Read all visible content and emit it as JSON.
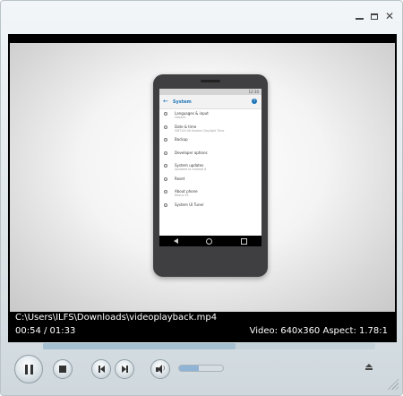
{
  "window": {
    "minimize_icon": "minimize-icon",
    "maximize_icon": "maximize-icon",
    "close_icon": "close-icon",
    "close_glyph": "✕"
  },
  "video": {
    "phone_screen": {
      "status_time": "12:30",
      "title": "System",
      "items": [
        {
          "title": "Languages & input",
          "subtitle": "Gboard"
        },
        {
          "title": "Date & time",
          "subtitle": "GMT-04:00 Eastern Daylight Time"
        },
        {
          "title": "Backup",
          "subtitle": ""
        },
        {
          "title": "Developer options",
          "subtitle": ""
        },
        {
          "title": "System updates",
          "subtitle": "Updated to Android 8"
        },
        {
          "title": "Reset",
          "subtitle": ""
        },
        {
          "title": "About phone",
          "subtitle": "Nexus 5X"
        },
        {
          "title": "System UI Tuner",
          "subtitle": ""
        }
      ]
    }
  },
  "info": {
    "file_path": "C:\\Users\\ILFS\\Downloads\\videoplayback.mp4",
    "time": "00:54 / 01:33",
    "video_info": "Video: 640x360 Aspect: 1.78:1"
  },
  "playback": {
    "progress_fraction": 0.58,
    "volume_fraction": 0.45
  },
  "controls": {
    "pause_icon": "pause-icon",
    "stop_icon": "stop-icon",
    "previous_icon": "skip-previous-icon",
    "next_icon": "skip-next-icon",
    "volume_icon": "speaker-icon",
    "eject_icon": "eject-icon"
  },
  "colors": {
    "video_background": "#000000",
    "text": "#ffffff",
    "seek_track": "#c6d2da",
    "seek_fill": "#a6bfd1",
    "accent": "#1a73b8"
  }
}
